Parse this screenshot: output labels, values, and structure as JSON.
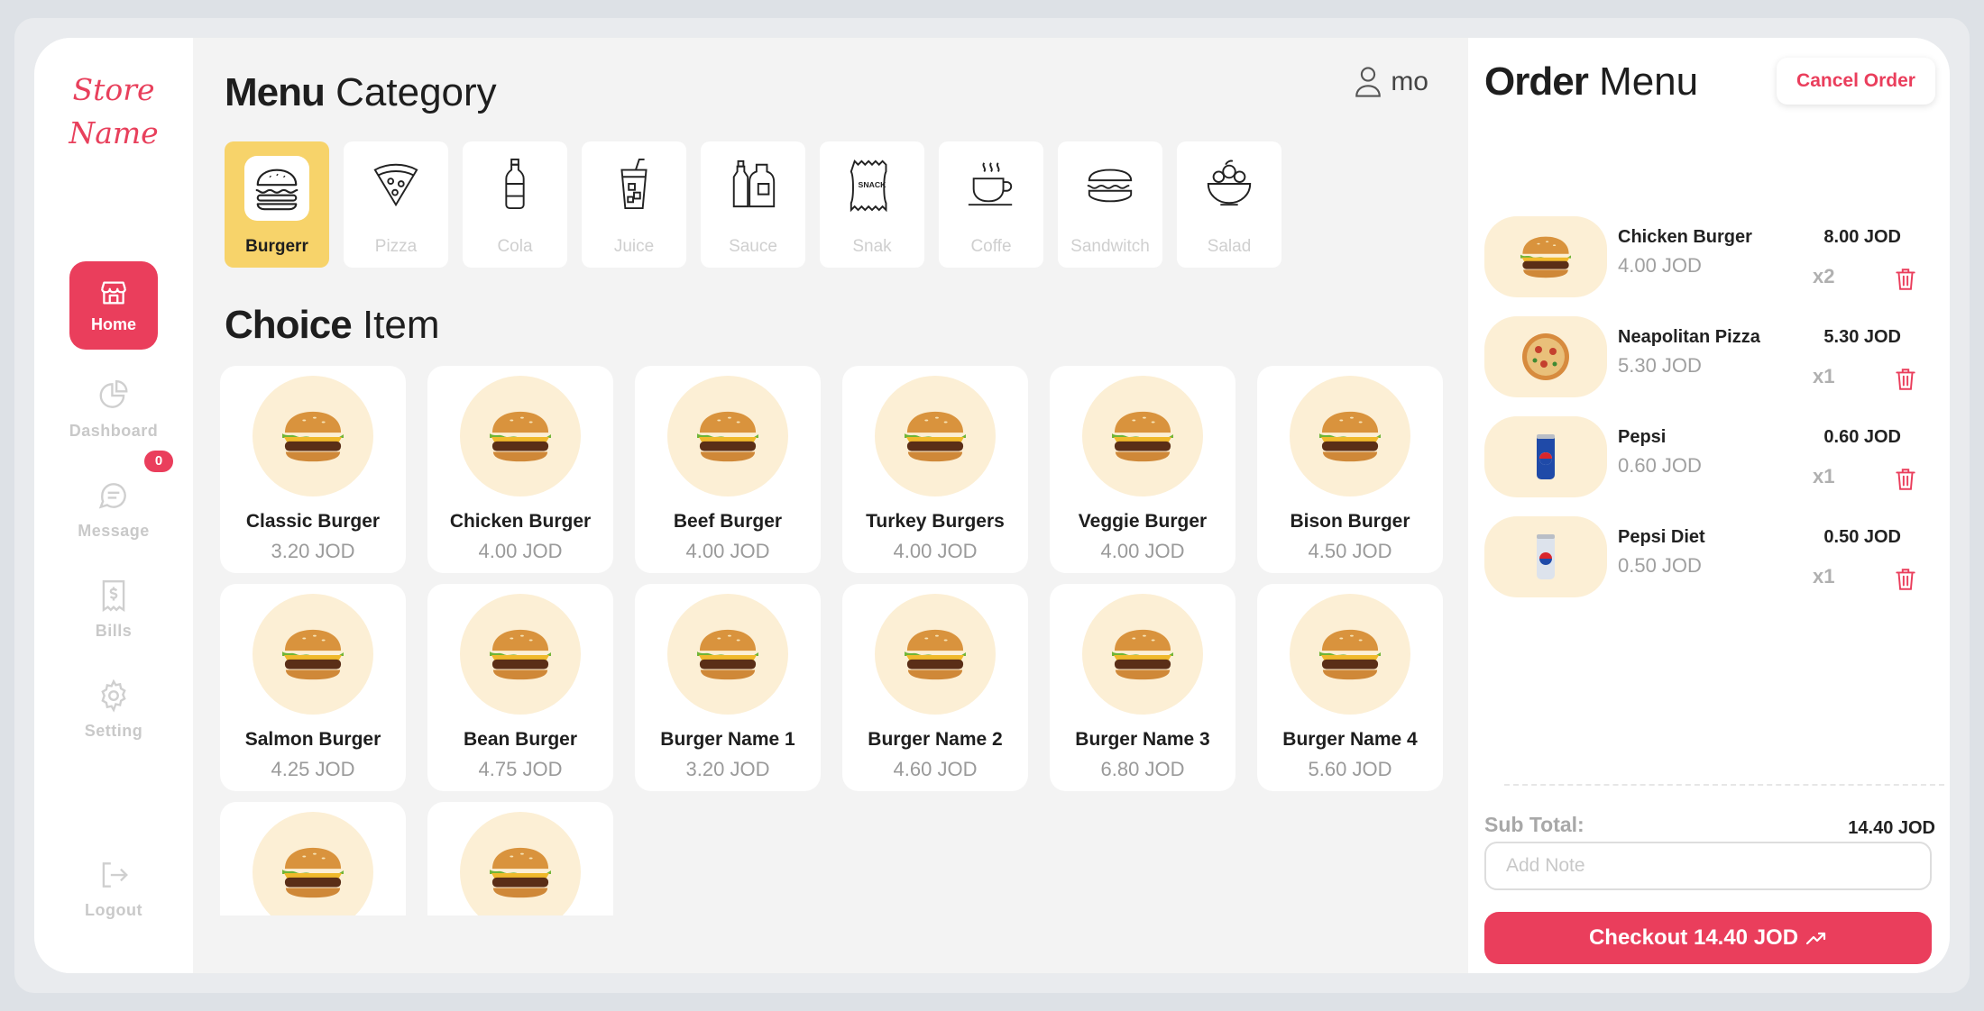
{
  "sidebar": {
    "logo": [
      "Store",
      "Name"
    ],
    "nav": {
      "home": "Home",
      "dashboard": "Dashboard",
      "message": "Message",
      "message_badge": "0",
      "bills": "Bills",
      "setting": "Setting",
      "logout": "Logout"
    }
  },
  "header": {
    "title_bold": "Menu",
    "title_light": "Category",
    "user": "mo"
  },
  "categories": [
    {
      "label": "Burgerr",
      "icon": "burger-icon",
      "active": true
    },
    {
      "label": "Pizza",
      "icon": "pizza-icon"
    },
    {
      "label": "Cola",
      "icon": "bottle-icon"
    },
    {
      "label": "Juice",
      "icon": "juice-icon"
    },
    {
      "label": "Sauce",
      "icon": "sauce-icon"
    },
    {
      "label": "Snak",
      "icon": "snack-icon"
    },
    {
      "label": "Coffe",
      "icon": "coffee-icon"
    },
    {
      "label": "Sandwitch",
      "icon": "sandwich-icon"
    },
    {
      "label": "Salad",
      "icon": "salad-icon"
    }
  ],
  "snack_icon_text": "SNACK",
  "items_section": {
    "title_bold": "Choice",
    "title_light": "Item"
  },
  "items": [
    {
      "name": "Classic Burger",
      "price": "3.20 JOD"
    },
    {
      "name": "Chicken Burger",
      "price": "4.00 JOD"
    },
    {
      "name": "Beef Burger",
      "price": "4.00 JOD"
    },
    {
      "name": "Turkey Burgers",
      "price": "4.00 JOD"
    },
    {
      "name": "Veggie Burger",
      "price": "4.00 JOD"
    },
    {
      "name": "Bison Burger",
      "price": "4.50 JOD"
    },
    {
      "name": "Salmon Burger",
      "price": "4.25 JOD"
    },
    {
      "name": "Bean Burger",
      "price": "4.75 JOD"
    },
    {
      "name": "Burger Name 1",
      "price": "3.20 JOD"
    },
    {
      "name": "Burger Name 2",
      "price": "4.60 JOD"
    },
    {
      "name": "Burger Name 3",
      "price": "6.80 JOD"
    },
    {
      "name": "Burger Name 4",
      "price": "5.60 JOD"
    },
    {
      "name": "",
      "price": ""
    },
    {
      "name": "",
      "price": ""
    }
  ],
  "order": {
    "title_bold": "Order",
    "title_light": "Menu",
    "cancel_label": "Cancel Order",
    "lines": [
      {
        "name": "Chicken Burger",
        "unit_price": "4.00 JOD",
        "total": "8.00 JOD",
        "qty": "x2",
        "kind": "burger"
      },
      {
        "name": "Neapolitan Pizza",
        "unit_price": "5.30 JOD",
        "total": "5.30 JOD",
        "qty": "x1",
        "kind": "pizza"
      },
      {
        "name": "Pepsi",
        "unit_price": "0.60 JOD",
        "total": "0.60 JOD",
        "qty": "x1",
        "kind": "can"
      },
      {
        "name": "Pepsi Diet",
        "unit_price": "0.50 JOD",
        "total": "0.50 JOD",
        "qty": "x1",
        "kind": "can-diet"
      }
    ],
    "subtotal_label": "Sub Total:",
    "subtotal_value": "14.40 JOD",
    "note_placeholder": "Add Note",
    "checkout_label": "Checkout 14.40 JOD"
  },
  "colors": {
    "accent": "#ea3e5c",
    "active_category": "#f7d36a",
    "plate": "#fcefd5"
  }
}
